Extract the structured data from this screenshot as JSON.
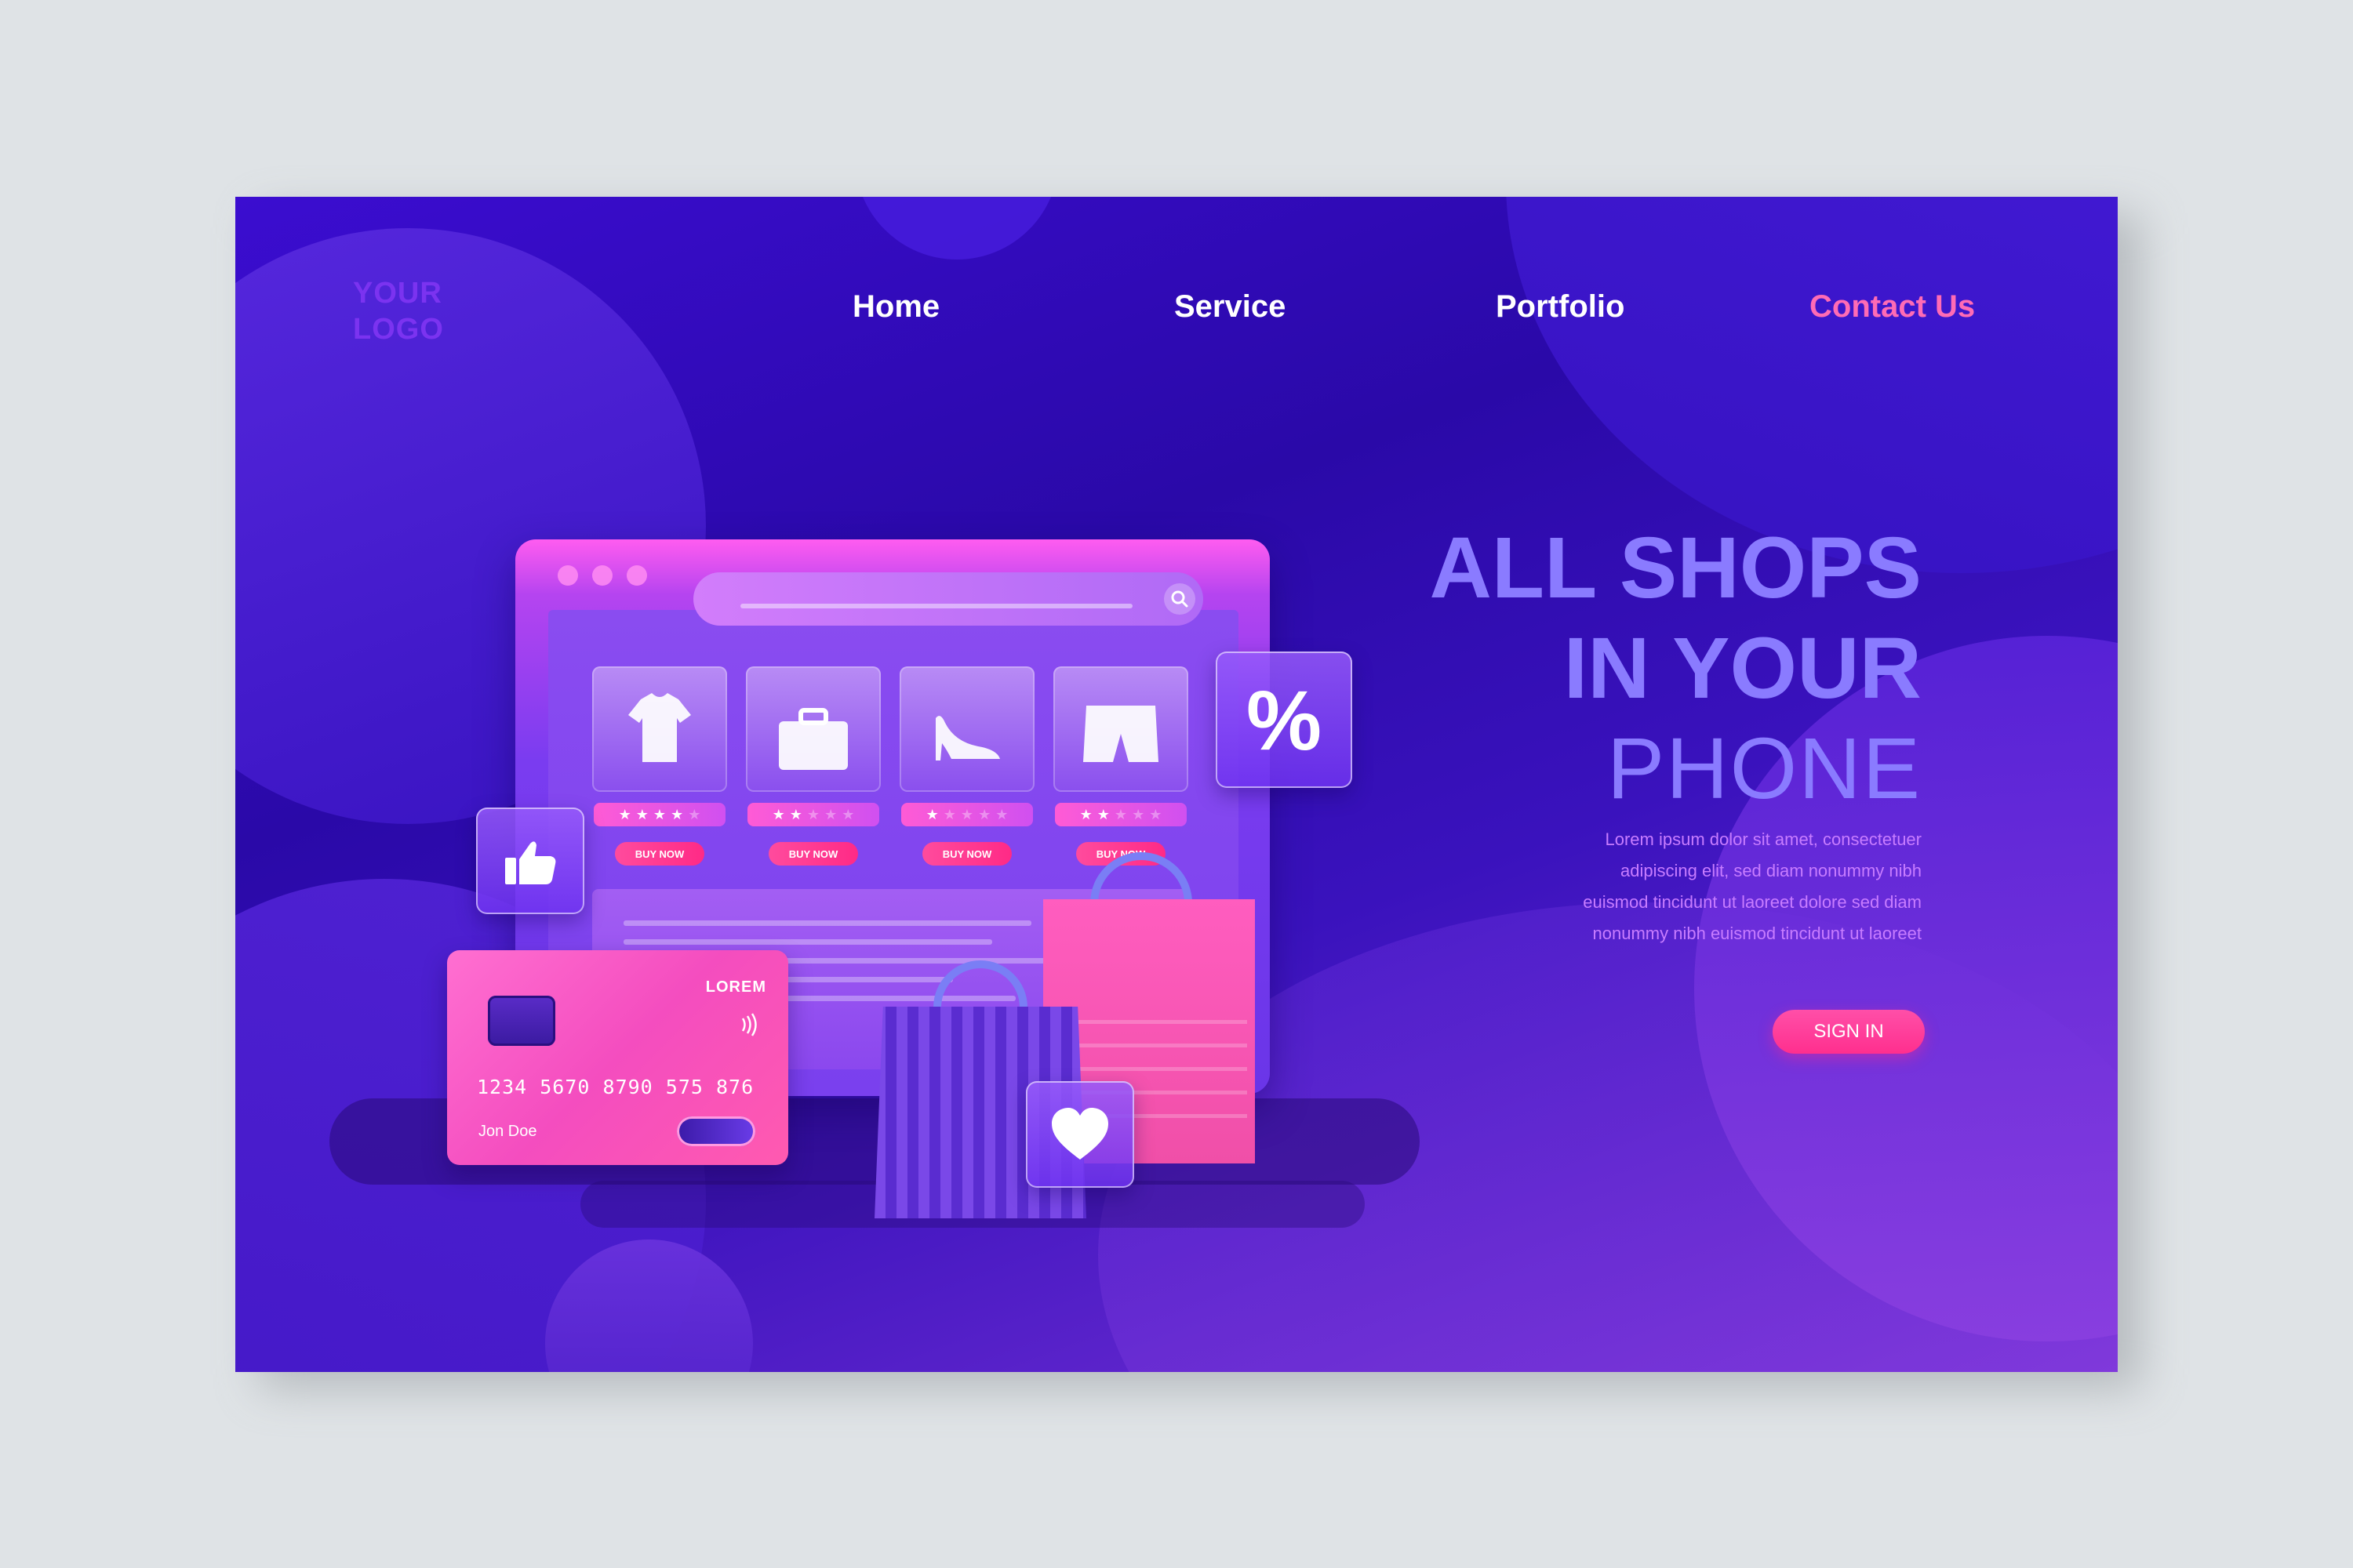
{
  "logo": {
    "line1": "YOUR",
    "line2": "LOGO"
  },
  "nav": {
    "home": "Home",
    "service": "Service",
    "portfolio": "Portfolio",
    "contact": "Contact Us"
  },
  "hero": {
    "title_line1": "ALL SHOPS",
    "title_line2": "IN YOUR",
    "title_line3": "PHONE",
    "body_lines": [
      "Lorem ipsum dolor sit amet, consectetuer",
      "adipiscing elit, sed diam nonummy nibh",
      "euismod tincidunt ut laoreet dolore sed diam",
      "nonummy nibh euismod tincidunt ut laoreet"
    ],
    "signin_label": "SIGN IN"
  },
  "shop": {
    "products": [
      {
        "icon": "tshirt-icon",
        "rating": 4,
        "buy_label": "BUY NOW"
      },
      {
        "icon": "briefcase-icon",
        "rating": 2,
        "buy_label": "BUY NOW"
      },
      {
        "icon": "high-heel-icon",
        "rating": 1,
        "buy_label": "BUY NOW"
      },
      {
        "icon": "shorts-icon",
        "rating": 2,
        "buy_label": "BUY NOW"
      }
    ],
    "percent_symbol": "%"
  },
  "card": {
    "brand": "LOREM",
    "number": "1234 5670 8790 575 876",
    "holder": "Jon Doe"
  },
  "colors": {
    "background": "#dfe3e6",
    "accent_pink": "#ff6bb5",
    "title_purple": "#8a7bff",
    "body_purple": "#c87cff",
    "logo_purple": "#7b33f0"
  }
}
